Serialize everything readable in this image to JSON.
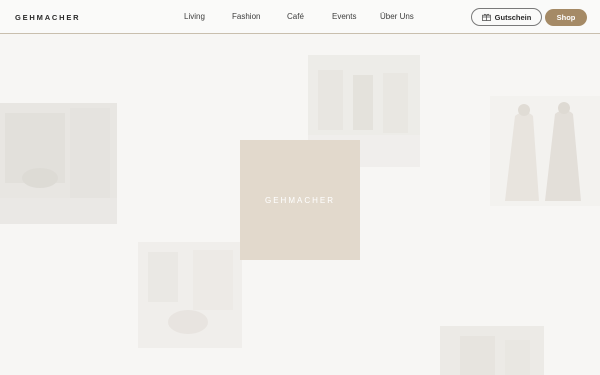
{
  "brand": {
    "name": "GEHMACHER"
  },
  "nav": {
    "items": [
      {
        "label": "Living"
      },
      {
        "label": "Fashion"
      },
      {
        "label": "Café"
      },
      {
        "label": "Events"
      },
      {
        "label": "Über Uns"
      }
    ]
  },
  "actions": {
    "voucher_label": "Gutschein",
    "shop_label": "Shop"
  },
  "hero": {
    "card_text": "GEHMACHER",
    "card_color": "#e2d9cc"
  },
  "colors": {
    "accent": "#a58a66",
    "header_border": "#c9bfae",
    "background": "#f7f6f4"
  }
}
